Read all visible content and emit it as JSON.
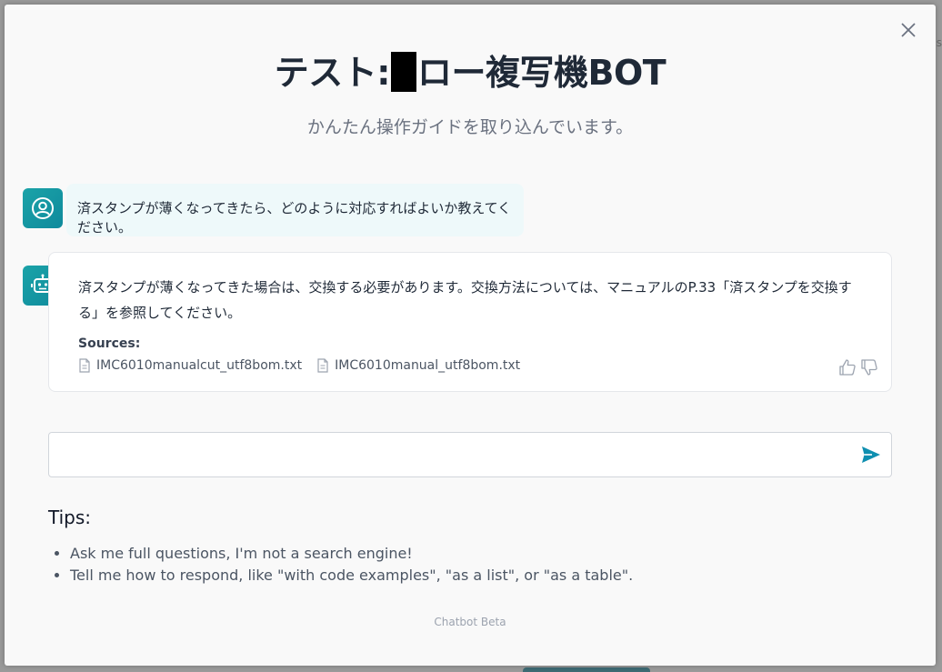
{
  "backdrop": {
    "edge_text": "s"
  },
  "modal": {
    "title_prefix": "テスト:",
    "title_suffix": "ロー複写機BOT",
    "subtitle": "かんたん操作ガイドを取り込んでいます。"
  },
  "conversation": {
    "user_message": "済スタンプが薄くなってきたら、どのように対応すればよいか教えてください。",
    "bot_message": "済スタンプが薄くなってきた場合は、交換する必要があります。交換方法については、マニュアルのP.33「済スタンプを交換する」を参照してください。",
    "sources_label": "Sources:",
    "sources": [
      {
        "name": "IMC6010manualcut_utf8bom.txt"
      },
      {
        "name": "IMC6010manual_utf8bom.txt"
      }
    ]
  },
  "input": {
    "placeholder": "",
    "value": ""
  },
  "tips": {
    "heading": "Tips:",
    "items": [
      "Ask me full questions, I'm not a search engine!",
      "Tell me how to respond, like \"with code examples\", \"as a list\", or \"as a table\"."
    ]
  },
  "footer": {
    "label": "Chatbot Beta"
  },
  "colors": {
    "accent": "#1ba3a8",
    "send": "#0f8fb0",
    "user_bubble": "#eef9fa",
    "modal_bg": "#f9f9f9"
  }
}
